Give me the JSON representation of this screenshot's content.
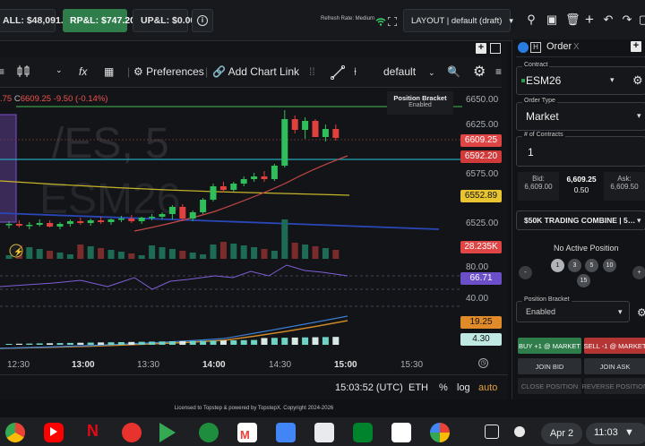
{
  "topbar": {
    "balance": "ALL: $48,091.60",
    "rpl": "RP&L: $747.20",
    "upl": "UP&L: $0.00",
    "refresh_rate": "Refresh Rate: Medium",
    "layout": "LAYOUT | default (draft)"
  },
  "chart_toolbar": {
    "indicators": "Preferences",
    "add_chart_link": "Add Chart Link",
    "template": "default",
    "fx": "fx"
  },
  "chart": {
    "ohlc_partial": ".75",
    "close_label": "C",
    "close_value": "6609.25",
    "change": "-9.50 (-0.14%)",
    "watermark_symbol": "/ES, 5",
    "watermark_name": "ESM26",
    "position_bracket_title": "Position Bracket",
    "position_bracket_status": "Enabled",
    "price_ticks": [
      "6650.00",
      "6625.00",
      "6575.00",
      "6525.00"
    ],
    "price_markers": {
      "last": "6609.25",
      "line1": "6592.20",
      "ma": "6552.89",
      "volume": "28.235K",
      "rsi": "66.71",
      "ind1": "19.25",
      "ind2": "4.30"
    },
    "rsi_ticks": [
      "80.00",
      "40.00"
    ],
    "time_ticks": [
      "12:30",
      "13:00",
      "13:30",
      "14:00",
      "14:30",
      "15:00",
      "15:30"
    ]
  },
  "chart_data": {
    "type": "candlestick",
    "times": [
      "12:30",
      "13:00",
      "13:30",
      "14:00",
      "14:30",
      "15:00"
    ],
    "last": 6609.25,
    "ylim": [
      6500,
      6655
    ],
    "candles": [
      {
        "o": 6512,
        "h": 6516,
        "l": 6508,
        "c": 6513,
        "up": true
      },
      {
        "o": 6513,
        "h": 6517,
        "l": 6509,
        "c": 6511,
        "up": false
      },
      {
        "o": 6511,
        "h": 6515,
        "l": 6507,
        "c": 6512,
        "up": true
      },
      {
        "o": 6512,
        "h": 6518,
        "l": 6510,
        "c": 6514,
        "up": true
      },
      {
        "o": 6514,
        "h": 6517,
        "l": 6509,
        "c": 6510,
        "up": false
      },
      {
        "o": 6510,
        "h": 6515,
        "l": 6507,
        "c": 6513,
        "up": true
      },
      {
        "o": 6513,
        "h": 6518,
        "l": 6510,
        "c": 6516,
        "up": true
      },
      {
        "o": 6516,
        "h": 6520,
        "l": 6512,
        "c": 6514,
        "up": false
      },
      {
        "o": 6514,
        "h": 6519,
        "l": 6511,
        "c": 6517,
        "up": true
      },
      {
        "o": 6517,
        "h": 6521,
        "l": 6513,
        "c": 6515,
        "up": false
      },
      {
        "o": 6515,
        "h": 6519,
        "l": 6512,
        "c": 6518,
        "up": true
      },
      {
        "o": 6518,
        "h": 6522,
        "l": 6515,
        "c": 6519,
        "up": true
      },
      {
        "o": 6519,
        "h": 6523,
        "l": 6514,
        "c": 6516,
        "up": false
      },
      {
        "o": 6516,
        "h": 6521,
        "l": 6513,
        "c": 6520,
        "up": true
      },
      {
        "o": 6520,
        "h": 6524,
        "l": 6517,
        "c": 6521,
        "up": true
      },
      {
        "o": 6521,
        "h": 6526,
        "l": 6518,
        "c": 6524,
        "up": true
      },
      {
        "o": 6524,
        "h": 6534,
        "l": 6518,
        "c": 6532,
        "up": true
      },
      {
        "o": 6532,
        "h": 6535,
        "l": 6516,
        "c": 6519,
        "up": false
      },
      {
        "o": 6519,
        "h": 6528,
        "l": 6516,
        "c": 6526,
        "up": true
      },
      {
        "o": 6526,
        "h": 6542,
        "l": 6524,
        "c": 6540,
        "up": true
      },
      {
        "o": 6540,
        "h": 6558,
        "l": 6538,
        "c": 6555,
        "up": true
      },
      {
        "o": 6555,
        "h": 6560,
        "l": 6548,
        "c": 6551,
        "up": false
      },
      {
        "o": 6551,
        "h": 6560,
        "l": 6549,
        "c": 6558,
        "up": true
      },
      {
        "o": 6558,
        "h": 6566,
        "l": 6555,
        "c": 6563,
        "up": true
      },
      {
        "o": 6563,
        "h": 6570,
        "l": 6560,
        "c": 6566,
        "up": true
      },
      {
        "o": 6566,
        "h": 6572,
        "l": 6560,
        "c": 6563,
        "up": false
      },
      {
        "o": 6563,
        "h": 6580,
        "l": 6561,
        "c": 6578,
        "up": true
      },
      {
        "o": 6578,
        "h": 6640,
        "l": 6576,
        "c": 6630,
        "up": true
      },
      {
        "o": 6630,
        "h": 6634,
        "l": 6614,
        "c": 6618,
        "up": false
      },
      {
        "o": 6618,
        "h": 6632,
        "l": 6608,
        "c": 6628,
        "up": true
      },
      {
        "o": 6628,
        "h": 6630,
        "l": 6612,
        "c": 6610,
        "up": false
      },
      {
        "o": 6610,
        "h": 6624,
        "l": 6605,
        "c": 6619,
        "up": true
      },
      {
        "o": 6619,
        "h": 6624,
        "l": 6606,
        "c": 6609,
        "up": false
      }
    ]
  },
  "bottombar": {
    "clock": "15:03:52 (UTC)",
    "session": "ETH",
    "pct": "%",
    "log": "log",
    "auto": "auto"
  },
  "order_panel": {
    "tab": "Order",
    "contract_label": "Contract",
    "contract": "ESM26",
    "order_type_label": "Order Type",
    "order_type": "Market",
    "contracts_label": "# of Contracts",
    "contracts": "1",
    "bid_label": "Bid:",
    "bid": "6,609.00",
    "last": "6,609.25",
    "spread": "0.50",
    "ask_label": "Ask:",
    "ask": "6,609.50",
    "account": "$50K TRADING COMBINE | 5…",
    "position_status": "No Active Position",
    "qty_buttons": [
      "1",
      "3",
      "5",
      "10",
      "15"
    ],
    "minus": "-",
    "plus": "+",
    "bracket_label": "Position Bracket",
    "bracket_value": "Enabled",
    "buy_market": "BUY +1 @ MARKET",
    "sell_market": "SELL -1 @ MARKET",
    "join_bid": "JOIN BID",
    "join_ask": "JOIN ASK",
    "close_position": "CLOSE POSITION",
    "reverse_position": "REVERSE POSITION"
  },
  "footer": {
    "license": "Licensed to Topstep & powered by TopstepX. Copyright 2024-2026"
  },
  "taskbar": {
    "date": "Apr 2",
    "time": "11:03"
  },
  "colors": {
    "up": "#26a69a",
    "down": "#ef5350",
    "accent_green": "#2e7d4a"
  }
}
